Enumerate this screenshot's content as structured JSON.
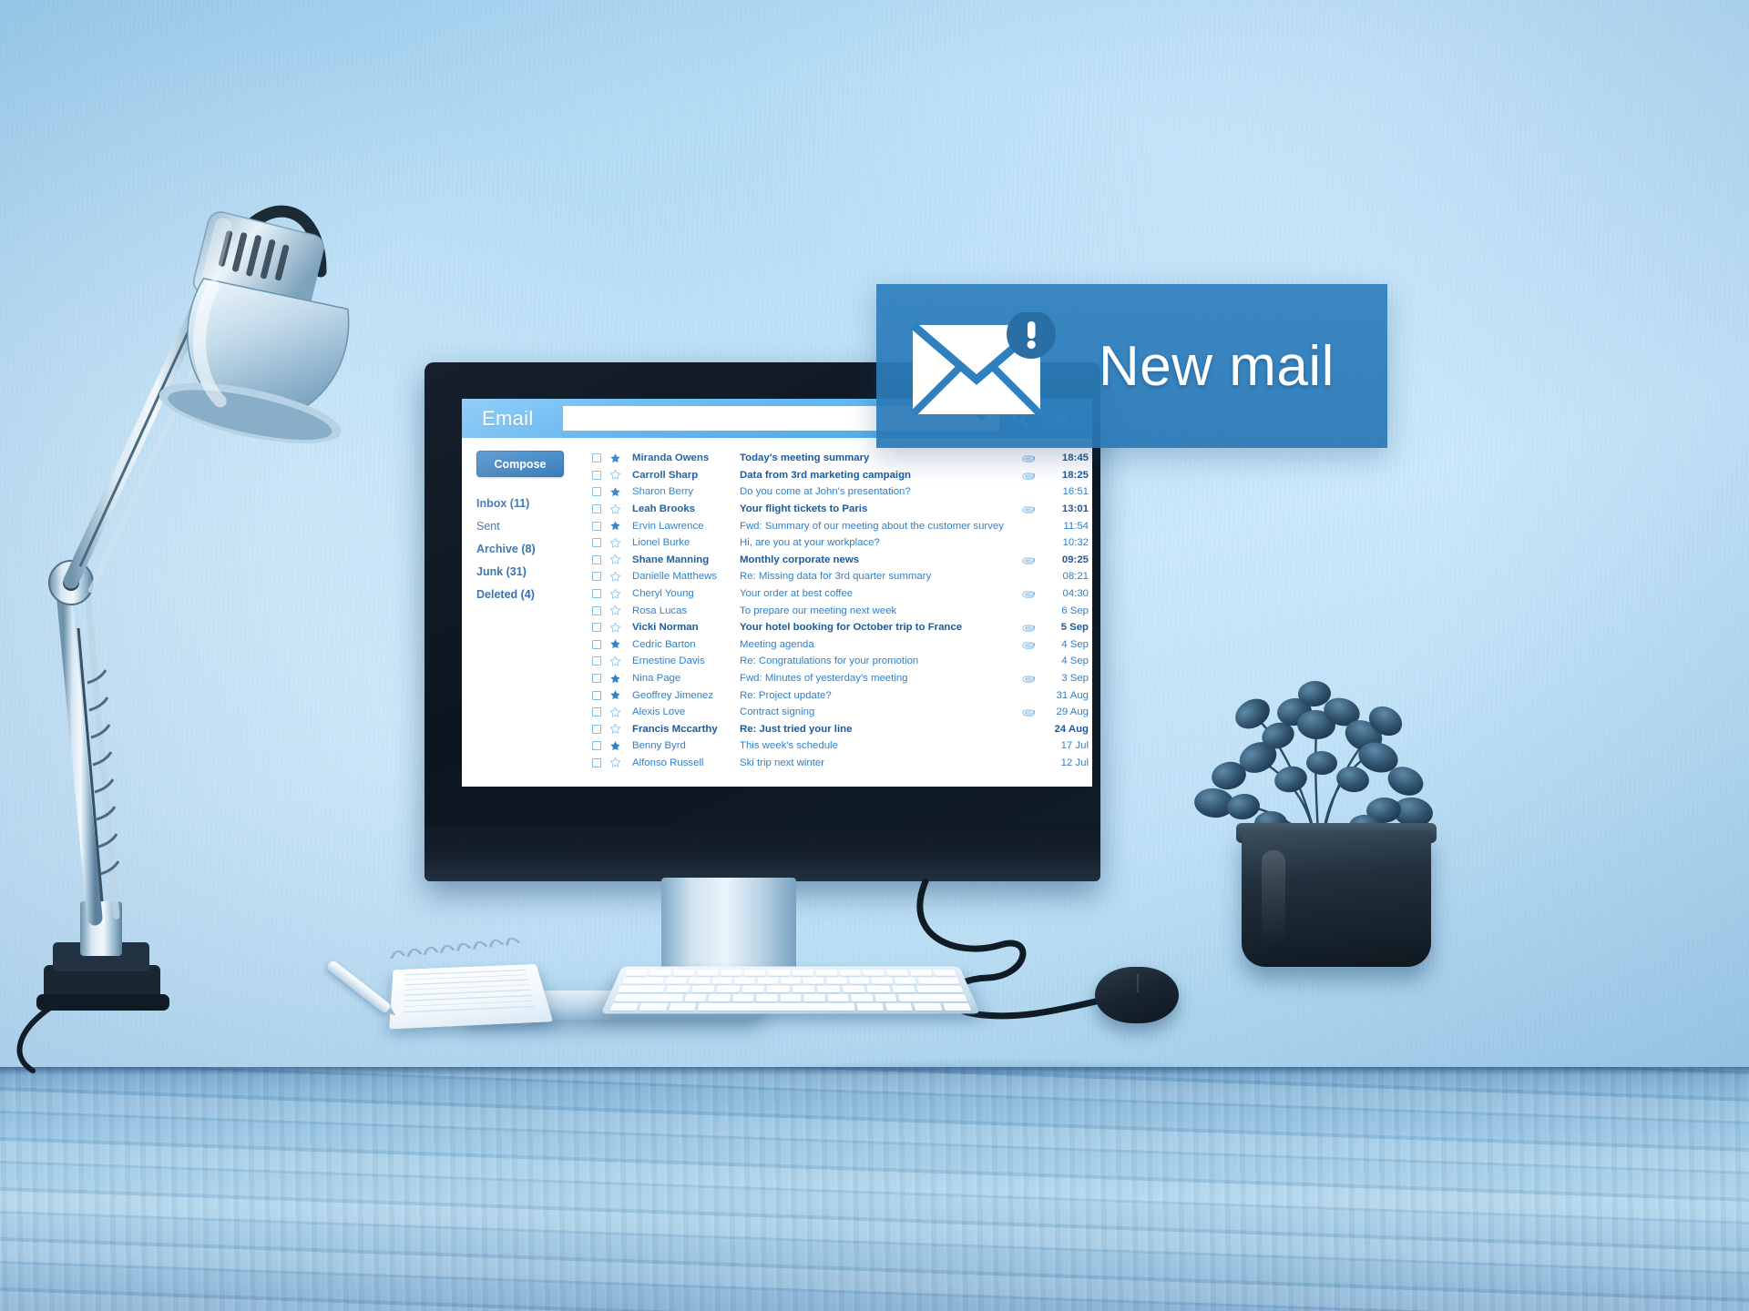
{
  "scene": {
    "description": "Desk workspace with monitor showing an email inbox, desk lamp, keyboard, mouse, notebook, pen and potted plant, blue color grading",
    "objects": [
      "desk-lamp",
      "monitor",
      "keyboard",
      "mouse",
      "notebook",
      "pen",
      "potted-plant",
      "cables"
    ]
  },
  "colors": {
    "accent": "#2f80be",
    "topbar": "#5cb3f0",
    "compose": "#1f69ad",
    "link": "#2f7fc9",
    "unread": "#1b5a9c",
    "star_filled": "#2f7fc9",
    "star_empty": "#9fcbeb",
    "wall": "#b9def5",
    "desk": "#96c4e2"
  },
  "app": {
    "title": "Email",
    "search": {
      "value": "",
      "placeholder": ""
    },
    "icons": {
      "dropdown": "chevron-down-icon",
      "search": "search-icon",
      "settings": "gear-icon"
    },
    "compose_label": "Compose",
    "folders": [
      {
        "label": "Inbox (11)",
        "bold": true
      },
      {
        "label": "Sent",
        "bold": false
      },
      {
        "label": "Archive (8)",
        "bold": true
      },
      {
        "label": "Junk (31)",
        "bold": true
      },
      {
        "label": "Deleted (4)",
        "bold": true
      }
    ],
    "messages": [
      {
        "sender": "Miranda Owens",
        "subject": "Today's meeting summary",
        "time": "18:45",
        "unread": true,
        "starred": true,
        "attachment": true
      },
      {
        "sender": "Carroll Sharp",
        "subject": "Data from 3rd marketing campaign",
        "time": "18:25",
        "unread": true,
        "starred": false,
        "attachment": true
      },
      {
        "sender": "Sharon Berry",
        "subject": "Do you come at John's presentation?",
        "time": "16:51",
        "unread": false,
        "starred": true,
        "attachment": false
      },
      {
        "sender": "Leah Brooks",
        "subject": "Your flight tickets to Paris",
        "time": "13:01",
        "unread": true,
        "starred": false,
        "attachment": true
      },
      {
        "sender": "Ervin Lawrence",
        "subject": "Fwd: Summary of our meeting about the customer survey",
        "time": "11:54",
        "unread": false,
        "starred": true,
        "attachment": false
      },
      {
        "sender": "Lionel Burke",
        "subject": "Hi, are you at your workplace?",
        "time": "10:32",
        "unread": false,
        "starred": false,
        "attachment": false
      },
      {
        "sender": "Shane Manning",
        "subject": "Monthly corporate news",
        "time": "09:25",
        "unread": true,
        "starred": false,
        "attachment": true
      },
      {
        "sender": "Danielle Matthews",
        "subject": "Re: Missing data for 3rd quarter summary",
        "time": "08:21",
        "unread": false,
        "starred": false,
        "attachment": false
      },
      {
        "sender": "Cheryl Young",
        "subject": "Your order at best coffee",
        "time": "04:30",
        "unread": false,
        "starred": false,
        "attachment": true
      },
      {
        "sender": "Rosa Lucas",
        "subject": "To prepare our meeting next week",
        "time": "6 Sep",
        "unread": false,
        "starred": false,
        "attachment": false
      },
      {
        "sender": "Vicki Norman",
        "subject": "Your hotel booking for October trip to France",
        "time": "5 Sep",
        "unread": true,
        "starred": false,
        "attachment": true
      },
      {
        "sender": "Cedric Barton",
        "subject": "Meeting agenda",
        "time": "4 Sep",
        "unread": false,
        "starred": true,
        "attachment": true
      },
      {
        "sender": "Ernestine Davis",
        "subject": "Re: Congratulations for your promotion",
        "time": "4 Sep",
        "unread": false,
        "starred": false,
        "attachment": false
      },
      {
        "sender": "Nina Page",
        "subject": "Fwd: Minutes of yesterday's meeting",
        "time": "3 Sep",
        "unread": false,
        "starred": true,
        "attachment": true
      },
      {
        "sender": "Geoffrey Jimenez",
        "subject": "Re: Project update?",
        "time": "31 Aug",
        "unread": false,
        "starred": true,
        "attachment": false
      },
      {
        "sender": "Alexis Love",
        "subject": "Contract signing",
        "time": "29 Aug",
        "unread": false,
        "starred": false,
        "attachment": true
      },
      {
        "sender": "Francis Mccarthy",
        "subject": "Re: Just tried your line",
        "time": "24 Aug",
        "unread": true,
        "starred": false,
        "attachment": false
      },
      {
        "sender": "Benny Byrd",
        "subject": "This week's schedule",
        "time": "17 Jul",
        "unread": false,
        "starred": true,
        "attachment": false
      },
      {
        "sender": "Alfonso Russell",
        "subject": "Ski trip next winter",
        "time": "12 Jul",
        "unread": false,
        "starred": false,
        "attachment": false
      }
    ]
  },
  "notification": {
    "text": "New mail",
    "icon": "envelope-alert-icon",
    "badge": "!"
  }
}
